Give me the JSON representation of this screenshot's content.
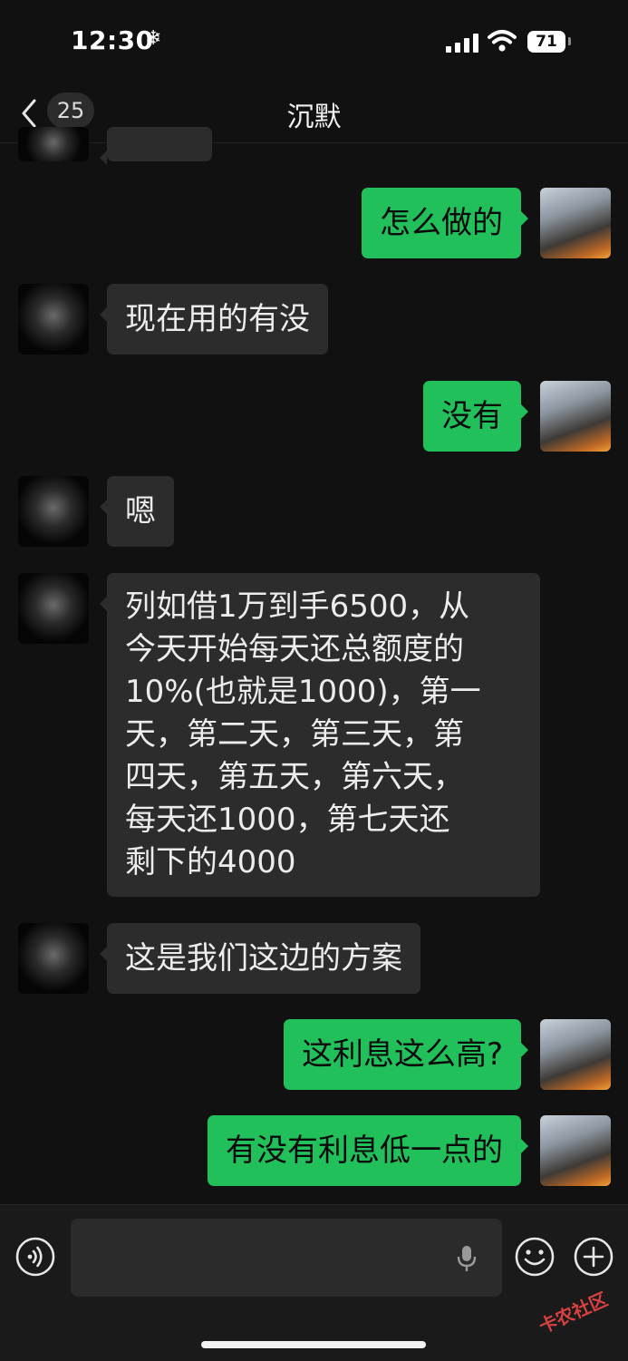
{
  "status_bar": {
    "time": "12:30",
    "focus_glyph": "❄",
    "battery": "71"
  },
  "nav": {
    "back_glyph": "chevron-left",
    "unread_count": "25",
    "title": "沉默",
    "more_glyph": "ellipsis"
  },
  "messages": [
    {
      "from": "me",
      "text": "怎么做的"
    },
    {
      "from": "other",
      "text": "现在用的有没"
    },
    {
      "from": "me",
      "text": "没有"
    },
    {
      "from": "other",
      "text": "嗯"
    },
    {
      "from": "other",
      "lines": [
        "列如借1万到手6500，从",
        "今天开始每天还总额度的",
        "10%(也就是1000)，第一",
        "天，第二天，第三天，第",
        "四天，第五天，第六天，",
        "每天还1000，第七天还",
        "剩下的4000"
      ]
    },
    {
      "from": "other",
      "text": "这是我们这边的方案"
    },
    {
      "from": "me",
      "text": "这利息这么高?"
    },
    {
      "from": "me",
      "text": "有没有利息低一点的"
    }
  ],
  "input": {
    "value": "",
    "placeholder": ""
  },
  "watermark": "卡农社区",
  "colors": {
    "background": "#111111",
    "bubble_me": "#21c05a",
    "bubble_other": "#2c2c2c",
    "watermark": "#d94040"
  }
}
